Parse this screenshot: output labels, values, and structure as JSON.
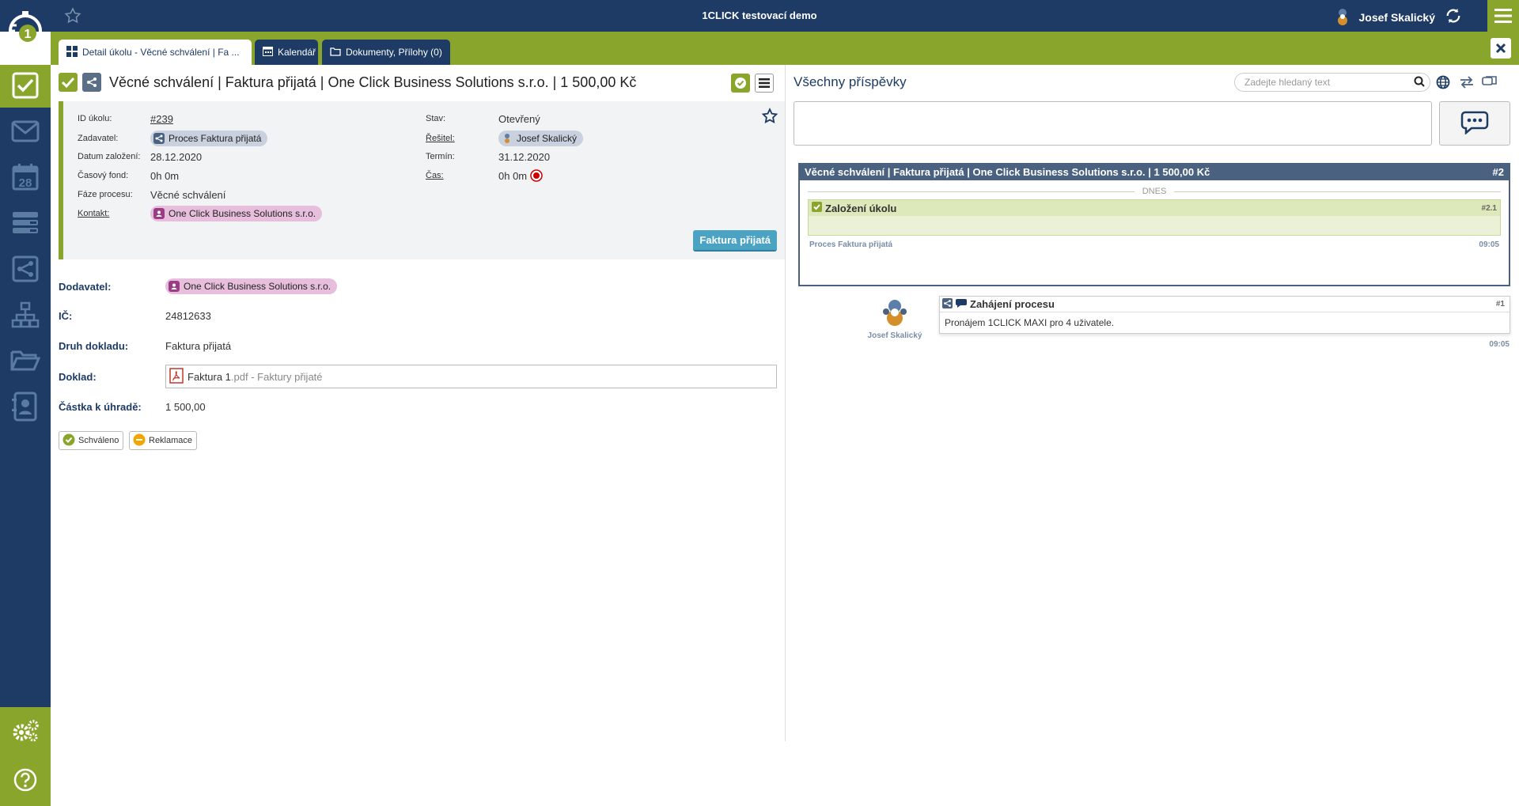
{
  "header": {
    "app_title": "1CLICK testovací demo",
    "user_name": "Josef Skalický"
  },
  "tabs": [
    {
      "label": "Detail úkolu - Věcné schválení | Fa ...",
      "icon": "grid-icon"
    },
    {
      "label": "Kalendář",
      "icon": "calendar-icon"
    },
    {
      "label": "Dokumenty, Přílohy (0)",
      "icon": "folder-icon"
    }
  ],
  "sidebar": {
    "items": [
      "tasks-icon",
      "mail-icon",
      "calendar-icon",
      "list-icon",
      "process-icon",
      "org-chart-icon",
      "folder-icon",
      "contacts-icon"
    ],
    "calendar_day": "28",
    "bottom": [
      "settings-icon",
      "help-icon"
    ]
  },
  "task": {
    "title": "Věcné schválení | Faktura přijatá | One Click Business Solutions s.r.o. | 1 500,00 Kč",
    "fields": {
      "id_label": "ID úkolu:",
      "id_value": "#239",
      "zadavatel_label": "Zadavatel:",
      "zadavatel_value": "Proces Faktura přijatá",
      "datum_label": "Datum založení:",
      "datum_value": "28.12.2020",
      "casovy_label": "Časový fond:",
      "casovy_value": "0h 0m",
      "faze_label": "Fáze procesu:",
      "faze_value": "Věcné schválení",
      "kontakt_label": "Kontakt:",
      "kontakt_value": "One Click Business Solutions s.r.o.",
      "stav_label": "Stav:",
      "stav_value": "Otevřený",
      "resitel_label": "Řešitel:",
      "resitel_value": "Josef Skalický",
      "termin_label": "Termín:",
      "termin_value": "31.12.2020",
      "cas_label": "Čas:",
      "cas_value": "0h 0m"
    },
    "process_button": "Faktura přijatá"
  },
  "details": {
    "dodavatel_label": "Dodavatel:",
    "dodavatel_value": "One Click Business Solutions s.r.o.",
    "ic_label": "IČ:",
    "ic_value": "24812633",
    "druh_label": "Druh dokladu:",
    "druh_value": "Faktura přijatá",
    "doklad_label": "Doklad:",
    "doklad_name": "Faktura 1",
    "doklad_ext": ".pdf - Faktury přijaté",
    "castka_label": "Částka k úhradě:",
    "castka_value": "1 500,00"
  },
  "actions": {
    "approve": "Schváleno",
    "complaint": "Reklamace"
  },
  "feed": {
    "title": "Všechny příspěvky",
    "search_placeholder": "Zadejte hledaný text",
    "thread": {
      "title": "Věcné schválení | Faktura přijatá | One Click Business Solutions s.r.o. | 1 500,00 Kč",
      "number": "#2",
      "day_label": "DNES",
      "entry_title": "Založení úkolu",
      "entry_number": "#2.1",
      "entry_author": "Proces Faktura přijatá",
      "entry_time": "09:05"
    },
    "post": {
      "author": "Josef Skalický",
      "title": "Zahájení procesu",
      "number": "#1",
      "text": "Pronájem 1CLICK MAXI pro 4 uživatele.",
      "time": "09:05"
    }
  },
  "colors": {
    "navy": "#1d3b64",
    "green": "#8aa52b",
    "button_blue": "#4aa3c3",
    "contact_pink": "#e7bfdc"
  }
}
